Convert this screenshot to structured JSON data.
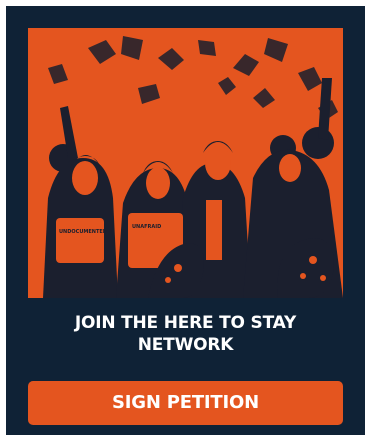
{
  "card": {
    "headline_line1": "JOIN THE HERE TO STAY",
    "headline_line2": "NETWORK",
    "cta_label": "SIGN PETITION"
  },
  "hero": {
    "description_icon": "protest-crowd-photo",
    "sign_text_left": "UNDOCUMENTED",
    "sign_text_middle": "UNAFRAID"
  },
  "colors": {
    "background": "#0f2236",
    "accent": "#e4551f",
    "text": "#ffffff"
  }
}
